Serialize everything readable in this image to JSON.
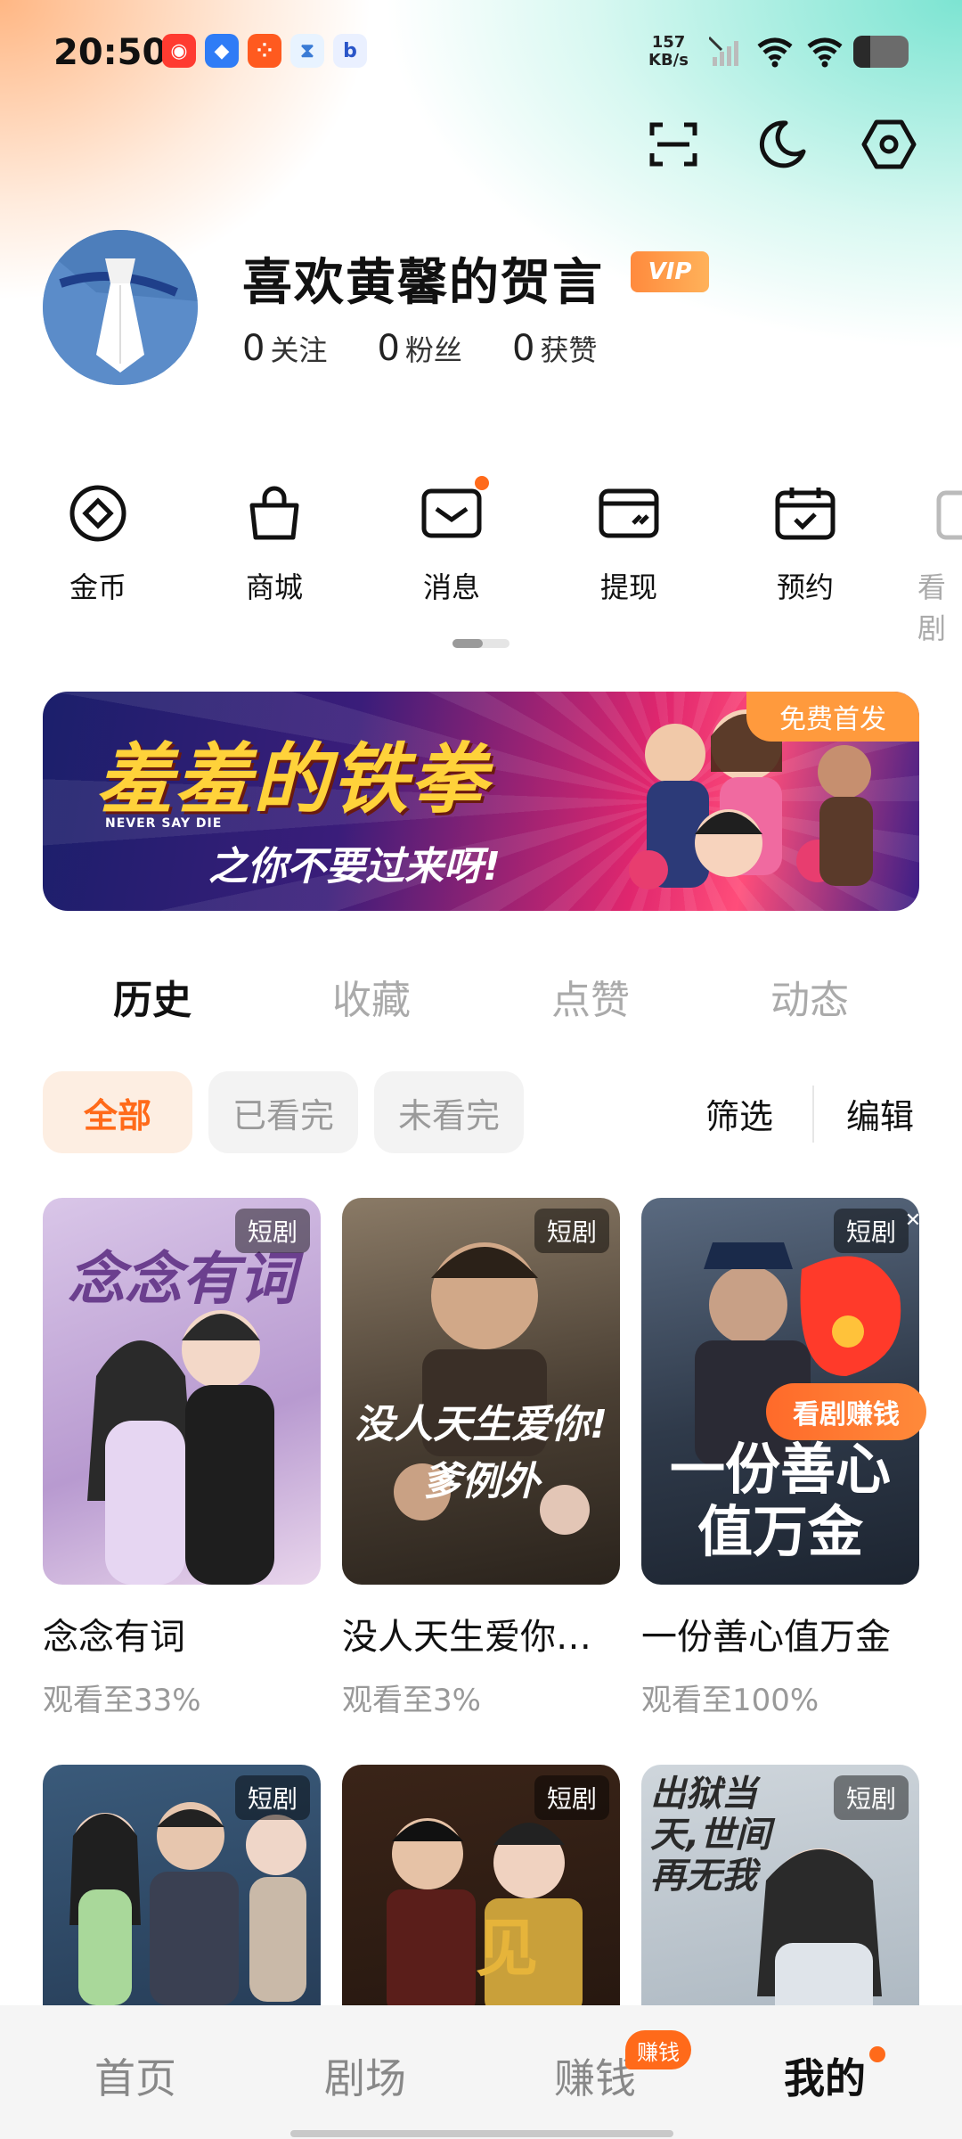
{
  "status_bar": {
    "time": "20:50",
    "net_speed_value": "157",
    "net_speed_unit": "KB/s",
    "battery_percent": 0.3,
    "notification_icons": [
      "qq-icon",
      "browser-icon",
      "app-grid-icon",
      "hourglass-icon",
      "baidu-icon"
    ]
  },
  "top_actions": [
    "scan-icon",
    "night-mode-icon",
    "settings-icon"
  ],
  "profile": {
    "username": "喜欢黄馨的贺言",
    "vip_label": "VIP",
    "stats": [
      {
        "num": "0",
        "label": "关注"
      },
      {
        "num": "0",
        "label": "粉丝"
      },
      {
        "num": "0",
        "label": "获赞"
      }
    ]
  },
  "features": [
    {
      "label": "金币",
      "icon": "coin-icon"
    },
    {
      "label": "商城",
      "icon": "shopping-bag-icon"
    },
    {
      "label": "消息",
      "icon": "message-icon"
    },
    {
      "label": "提现",
      "icon": "wallet-icon"
    },
    {
      "label": "预约",
      "icon": "calendar-icon"
    },
    {
      "label": "看剧",
      "icon": "watch-icon"
    }
  ],
  "banner": {
    "title": "羞羞的铁拳",
    "subtitle": "NEVER SAY DIE",
    "tagline": "之你不要过来呀!",
    "badge": "免费首发"
  },
  "tabs": [
    {
      "label": "历史",
      "active": true
    },
    {
      "label": "收藏",
      "active": false
    },
    {
      "label": "点赞",
      "active": false
    },
    {
      "label": "动态",
      "active": false
    }
  ],
  "filters": {
    "chips": [
      "全部",
      "已看完",
      "未看完"
    ],
    "filter_label": "筛选",
    "edit_label": "编辑"
  },
  "cards": [
    {
      "title": "念念有词",
      "progress": "观看至33%",
      "tag": "短剧",
      "poster_text": "念念有词"
    },
    {
      "title": "没人天生爱你…",
      "progress": "观看至3%",
      "tag": "短剧",
      "poster_text": "没人天生爱你!爹例外"
    },
    {
      "title": "一份善心值万金",
      "progress": "观看至100%",
      "tag": "短剧",
      "poster_text": "一份善心值万金"
    },
    {
      "tag": "短剧"
    },
    {
      "tag": "短剧"
    },
    {
      "tag": "短剧",
      "poster_text": "出狱当天,世间再无我"
    }
  ],
  "earn_button": "看剧赚钱",
  "bottom_nav": {
    "items": [
      {
        "label": "首页",
        "active": false
      },
      {
        "label": "剧场",
        "active": false
      },
      {
        "label": "赚钱",
        "active": false
      },
      {
        "label": "我的",
        "active": true
      }
    ],
    "earn_badge": "赚钱"
  }
}
